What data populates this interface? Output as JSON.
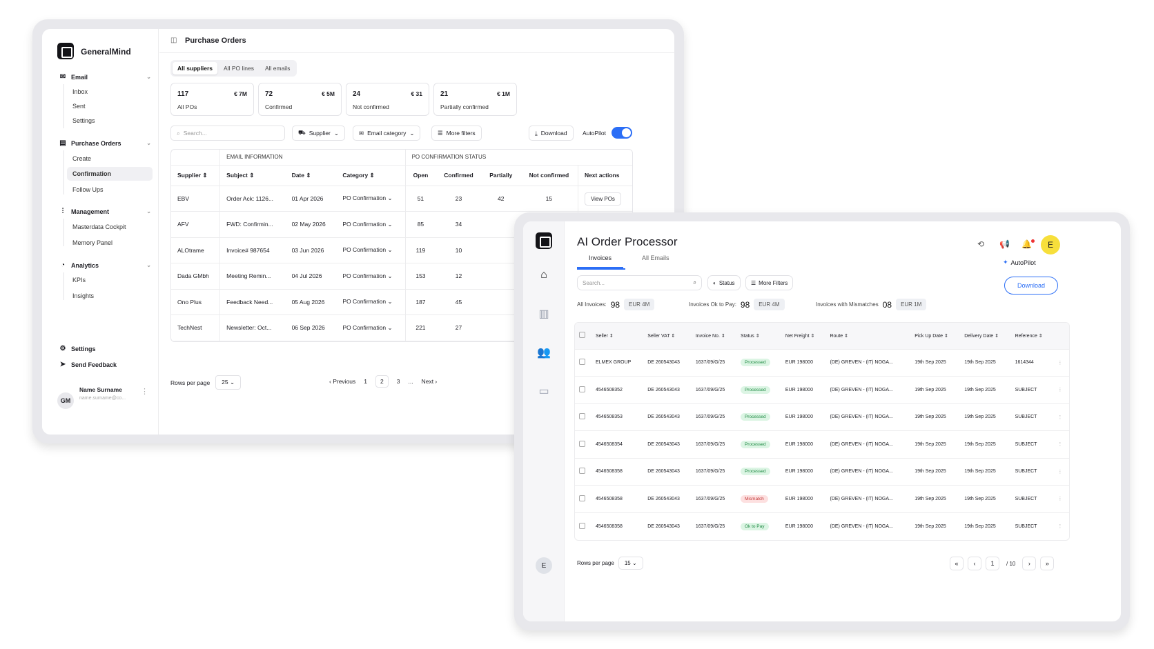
{
  "app1": {
    "brand": "GeneralMind",
    "page_title": "Purchase Orders",
    "nav": [
      {
        "label": "Email",
        "icon": "mail-icon",
        "items": [
          "Inbox",
          "Sent",
          "Settings"
        ]
      },
      {
        "label": "Purchase Orders",
        "icon": "clipboard-icon",
        "items": [
          "Create",
          "Confirmation",
          "Follow Ups"
        ]
      },
      {
        "label": "Management",
        "icon": "sliders-icon",
        "items": [
          "Masterdata Cockpit",
          "Memory Panel"
        ]
      },
      {
        "label": "Analytics",
        "icon": "pie-icon",
        "items": [
          "KPIs",
          "Insights"
        ]
      }
    ],
    "footer": {
      "settings": "Settings",
      "feedback": "Send Feedback"
    },
    "user": {
      "initials": "GM",
      "name": "Name Surname",
      "email": "name.surname@co..."
    },
    "tabs": [
      "All suppliers",
      "All PO lines",
      "All emails"
    ],
    "stats": [
      {
        "count": "117",
        "value": "€ 7M",
        "label": "All POs"
      },
      {
        "count": "72",
        "value": "€ 5M",
        "label": "Confirmed"
      },
      {
        "count": "24",
        "value": "€ 31",
        "label": "Not confirmed"
      },
      {
        "count": "21",
        "value": "€ 1M",
        "label": "Partially confirmed"
      }
    ],
    "search_placeholder": "Search...",
    "filters": {
      "supplier": "Supplier",
      "email_category": "Email category",
      "more": "More filters"
    },
    "download": "Download",
    "autopilot": "AutoPilot",
    "table": {
      "group_email": "EMAIL INFORMATION",
      "group_po": "PO CONFIRMATION STATUS",
      "headers": [
        "Supplier",
        "Subject",
        "Date",
        "Category",
        "Open",
        "Confirmed",
        "Partially",
        "Not confirmed",
        "Next actions"
      ],
      "view_label": "View POs",
      "rows": [
        {
          "supplier": "EBV",
          "subject": "Order Ack: 1126...",
          "date": "01 Apr 2026",
          "category": "PO Confirmation",
          "open": "51",
          "confirmed": "23",
          "partially": "42",
          "not_confirmed": "15"
        },
        {
          "supplier": "AFV",
          "subject": "FWD: Confirmin...",
          "date": "02 May 2026",
          "category": "PO Confirmation",
          "open": "85",
          "confirmed": "34"
        },
        {
          "supplier": "ALOtrame",
          "subject": "Invoice# 987654",
          "date": "03 Jun 2026",
          "category": "PO Confirmation",
          "open": "119",
          "confirmed": "10"
        },
        {
          "supplier": "Dada GMbh",
          "subject": "Meeting Remin...",
          "date": "04 Jul 2026",
          "category": "PO Confirmation",
          "open": "153",
          "confirmed": "12"
        },
        {
          "supplier": "Ono Plus",
          "subject": "Feedback Need...",
          "date": "05 Aug 2026",
          "category": "PO Confirmation",
          "open": "187",
          "confirmed": "45"
        },
        {
          "supplier": "TechNest",
          "subject": "Newsletter: Oct...",
          "date": "06 Sep 2026",
          "category": "PO Confirmation",
          "open": "221",
          "confirmed": "27"
        }
      ]
    },
    "pagination": {
      "rows_label": "Rows per page",
      "rows_value": "25",
      "prev": "Previous",
      "pages": [
        "1",
        "2",
        "3",
        "..."
      ],
      "next": "Next"
    }
  },
  "app2": {
    "title": "AI Order Processor",
    "tabs": [
      "Invoices",
      "All Emails"
    ],
    "autopilot": "AutoPilot",
    "search_placeholder": "Search...",
    "status_filter": "Status",
    "more_filters": "More Filters",
    "download": "Download",
    "avatar": "E",
    "sidebar_avatar": "E",
    "kpis": [
      {
        "label": "All Invoices:",
        "count": "98",
        "amount": "EUR 4M"
      },
      {
        "label": "Invoices Ok to Pay:",
        "count": "98",
        "amount": "EUR 4M"
      },
      {
        "label": "Invoices with Mismatches",
        "count": "08",
        "amount": "EUR 1M"
      }
    ],
    "table": {
      "headers": [
        "Seller",
        "Seller VAT",
        "Invoice No.",
        "Status",
        "Net Freight",
        "Route",
        "Pick Up Date",
        "Delivery Date",
        "Reference"
      ],
      "rows": [
        {
          "seller": "ELMEX GROUP",
          "vat": "DE 260543043",
          "inv": "1637/09/G/25",
          "status": "Processed",
          "kind": "ok",
          "freight": "EUR 198000",
          "route": "(DE) GREVEN - (IT) NOGA...",
          "pickup": "19th Sep 2025",
          "delivery": "19th Sep 2025",
          "ref": "1614344"
        },
        {
          "seller": "4546508352",
          "vat": "DE 260543043",
          "inv": "1637/09/G/25",
          "status": "Processed",
          "kind": "ok",
          "freight": "EUR 198000",
          "route": "(DE) GREVEN - (IT) NOGA...",
          "pickup": "19th Sep 2025",
          "delivery": "19th Sep 2025",
          "ref": "SUBJECT"
        },
        {
          "seller": "4546508353",
          "vat": "DE 260543043",
          "inv": "1637/09/G/25",
          "status": "Processed",
          "kind": "ok",
          "freight": "EUR 198000",
          "route": "(DE) GREVEN - (IT) NOGA...",
          "pickup": "19th Sep 2025",
          "delivery": "19th Sep 2025",
          "ref": "SUBJECT"
        },
        {
          "seller": "4546508354",
          "vat": "DE 260543043",
          "inv": "1637/09/G/25",
          "status": "Processed",
          "kind": "ok",
          "freight": "EUR 198000",
          "route": "(DE) GREVEN - (IT) NOGA...",
          "pickup": "19th Sep 2025",
          "delivery": "19th Sep 2025",
          "ref": "SUBJECT"
        },
        {
          "seller": "4546508358",
          "vat": "DE 260543043",
          "inv": "1637/09/G/25",
          "status": "Processed",
          "kind": "ok",
          "freight": "EUR 198000",
          "route": "(DE) GREVEN - (IT) NOGA...",
          "pickup": "19th Sep 2025",
          "delivery": "19th Sep 2025",
          "ref": "SUBJECT"
        },
        {
          "seller": "4546508358",
          "vat": "DE 260543043",
          "inv": "1637/09/G/25",
          "status": "Mismatch",
          "kind": "bad",
          "freight": "EUR 198000",
          "route": "(DE) GREVEN - (IT) NOGA...",
          "pickup": "19th Sep 2025",
          "delivery": "19th Sep 2025",
          "ref": "SUBJECT"
        },
        {
          "seller": "4546508358",
          "vat": "DE 260543043",
          "inv": "1637/09/G/25",
          "status": "Ok to Pay",
          "kind": "ok",
          "freight": "EUR 198000",
          "route": "(DE) GREVEN - (IT) NOGA...",
          "pickup": "19th Sep 2025",
          "delivery": "19th Sep 2025",
          "ref": "SUBJECT"
        }
      ]
    },
    "pagination": {
      "rows_label": "Rows per page",
      "rows_value": "15",
      "page": "1",
      "total": "/ 10"
    }
  },
  "colors": {
    "accent": "#2b6ef6",
    "ok": "#1f8a43",
    "mismatch": "#c43a3a",
    "avatar": "#f7df3b"
  }
}
